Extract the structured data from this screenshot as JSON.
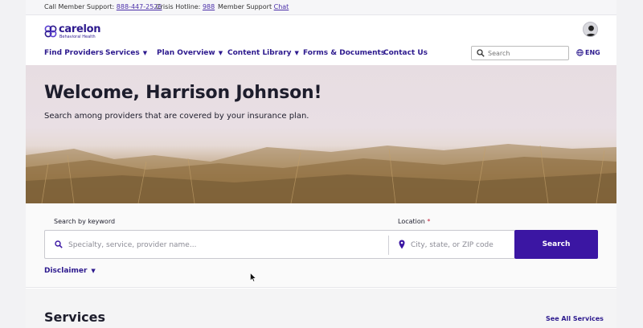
{
  "topbar": {
    "support_label": "Call Member Support:",
    "support_phone": "888-447-2526",
    "crisis_label": "Crisis Hotline:",
    "crisis_number": "988",
    "chat_label": "Member Support",
    "chat_link": "Chat"
  },
  "logo": {
    "word": "carelon",
    "sub": "Behavioral Health",
    "color": "#2d1a8e"
  },
  "nav": {
    "items": [
      {
        "label": "Find Providers",
        "dropdown": false
      },
      {
        "label": "Services",
        "dropdown": true
      },
      {
        "label": "Plan Overview",
        "dropdown": true
      },
      {
        "label": "Content Library",
        "dropdown": true
      },
      {
        "label": "Forms & Documents",
        "dropdown": false
      },
      {
        "label": "Contact Us",
        "dropdown": false
      }
    ],
    "search_placeholder": "Search",
    "language": "ENG"
  },
  "hero": {
    "title": "Welcome, Harrison Johnson!",
    "subtitle": "Search among providers that are covered by your insurance plan."
  },
  "search": {
    "keyword_label": "Search by keyword",
    "keyword_placeholder": "Specialty, service, provider name...",
    "location_label": "Location",
    "location_required": "*",
    "location_placeholder": "City, state, or ZIP code",
    "button": "Search"
  },
  "disclaimer": {
    "label": "Disclaimer"
  },
  "services": {
    "heading": "Services",
    "see_all": "See All Services"
  },
  "colors": {
    "brand": "#2d1a8e",
    "button": "#3b16a3",
    "required": "#c0203a"
  },
  "icons": [
    "user-avatar-icon",
    "search-icon",
    "globe-icon",
    "location-pin-icon",
    "chevron-down-icon",
    "mouse-cursor"
  ]
}
